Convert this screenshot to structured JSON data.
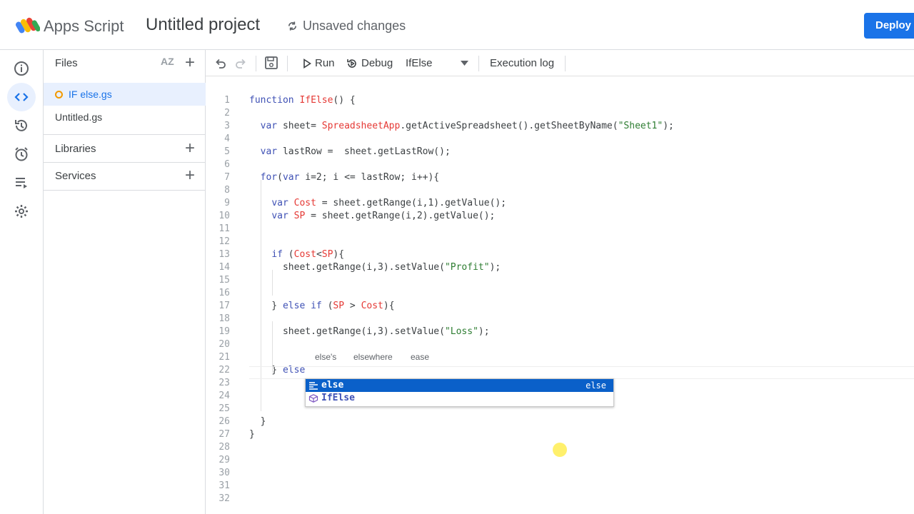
{
  "header": {
    "app_name": "Apps Script",
    "project_title": "Untitled project",
    "unsaved": "Unsaved changes",
    "deploy": "Deploy"
  },
  "rail": {
    "items": [
      "overview-icon",
      "editor-icon",
      "history-icon",
      "triggers-icon",
      "executions-icon",
      "settings-icon"
    ]
  },
  "files": {
    "title": "Files",
    "sort_label": "AZ",
    "items": [
      {
        "name": "IF else.gs",
        "active": true
      },
      {
        "name": "Untitled.gs",
        "active": false
      }
    ],
    "libraries": "Libraries",
    "services": "Services"
  },
  "toolbar": {
    "run": "Run",
    "debug": "Debug",
    "function": "IfElse",
    "execution_log": "Execution log"
  },
  "editor": {
    "line_numbers": [
      "1",
      "2",
      "3",
      "4",
      "5",
      "6",
      "7",
      "8",
      "9",
      "10",
      "11",
      "12",
      "13",
      "14",
      "15",
      "16",
      "17",
      "18",
      "19",
      "20",
      "21",
      "22",
      "23",
      "24",
      "25",
      "26",
      "27",
      "28",
      "29",
      "30",
      "31",
      "32"
    ],
    "lines": [
      "function IfElse() {",
      "",
      "  var sheet= SpreadsheetApp.getActiveSpreadsheet().getSheetByName(\"Sheet1\");",
      "",
      "  var lastRow =  sheet.getLastRow();",
      "",
      "  for(var i=2; i <= lastRow; i++){",
      "",
      "    var Cost = sheet.getRange(i,1).getValue();",
      "    var SP = sheet.getRange(i,2).getValue();",
      "",
      "",
      "    if (Cost<SP){",
      "      sheet.getRange(i,3).setValue(\"Profit\");",
      "",
      "",
      "    } else if (SP > Cost){",
      "",
      "      sheet.getRange(i,3).setValue(\"Loss\");",
      "",
      "",
      "    } else",
      "",
      "",
      "",
      "  }",
      "}",
      "",
      "",
      "",
      "",
      ""
    ],
    "inline_suggestions": [
      "else's",
      "elsewhere",
      "ease"
    ],
    "autocomplete": [
      {
        "label": "else",
        "hint": "else",
        "icon": "keyword-snippet-icon",
        "selected": true
      },
      {
        "label": "IfElse",
        "hint": "",
        "icon": "method-cube-icon",
        "selected": false
      }
    ]
  },
  "colors": {
    "accent": "#1a73e8",
    "keyword": "#3f51b5",
    "identifier": "#e53935",
    "string": "#2e7d32",
    "selection": "#0a60c9",
    "file_dot": "#f29900"
  }
}
